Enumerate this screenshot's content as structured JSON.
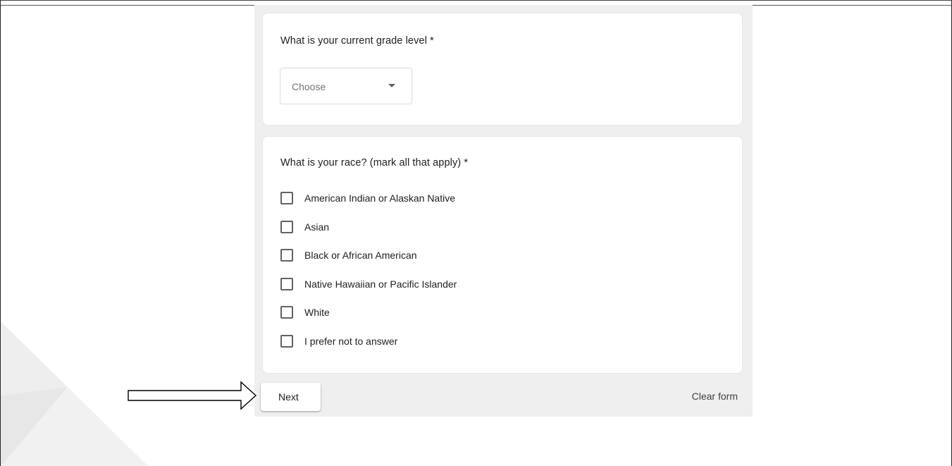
{
  "form": {
    "questions": [
      {
        "title": "What is your current grade level *",
        "type": "dropdown",
        "selected_value": "Choose"
      },
      {
        "title": "What is your race? (mark all that apply) *",
        "type": "checkbox",
        "options": [
          {
            "label": "American Indian or Alaskan Native",
            "checked": false
          },
          {
            "label": "Asian",
            "checked": false
          },
          {
            "label": "Black or African American",
            "checked": false
          },
          {
            "label": "Native Hawaiian or Pacific Islander",
            "checked": false
          },
          {
            "label": "White",
            "checked": false
          },
          {
            "label": "I prefer not to answer",
            "checked": false
          }
        ]
      }
    ],
    "next_label": "Next",
    "clear_label": "Clear form"
  },
  "icons": {
    "dropdown_caret": "chevron-down-icon",
    "annotation_arrow": "right-arrow-icon"
  },
  "colors": {
    "form_background": "#efefef",
    "card_background": "#ffffff",
    "checkbox_border": "#5f6368",
    "text_primary": "#202124",
    "text_muted": "#70757a"
  }
}
